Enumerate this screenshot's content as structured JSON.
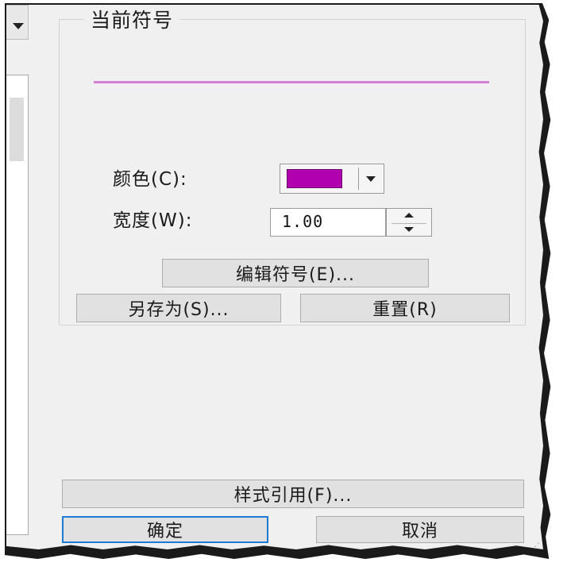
{
  "group": {
    "title": "当前符号"
  },
  "symbol": {
    "preview_color": "#d47fd4"
  },
  "color": {
    "label": "颜色(C):",
    "value": "#b000b0"
  },
  "width": {
    "label": "宽度(W):",
    "value": "1.00"
  },
  "buttons": {
    "edit_symbol": "编辑符号(E)...",
    "save_as": "另存为(S)...",
    "reset": "重置(R)",
    "style_reference": "样式引用(F)...",
    "ok": "确定",
    "cancel": "取消"
  },
  "icons": {
    "dropdown": "chevron-down-icon",
    "stepper_up": "arrow-up-icon",
    "stepper_down": "arrow-down-icon",
    "grip": "resize-grip-icon"
  }
}
